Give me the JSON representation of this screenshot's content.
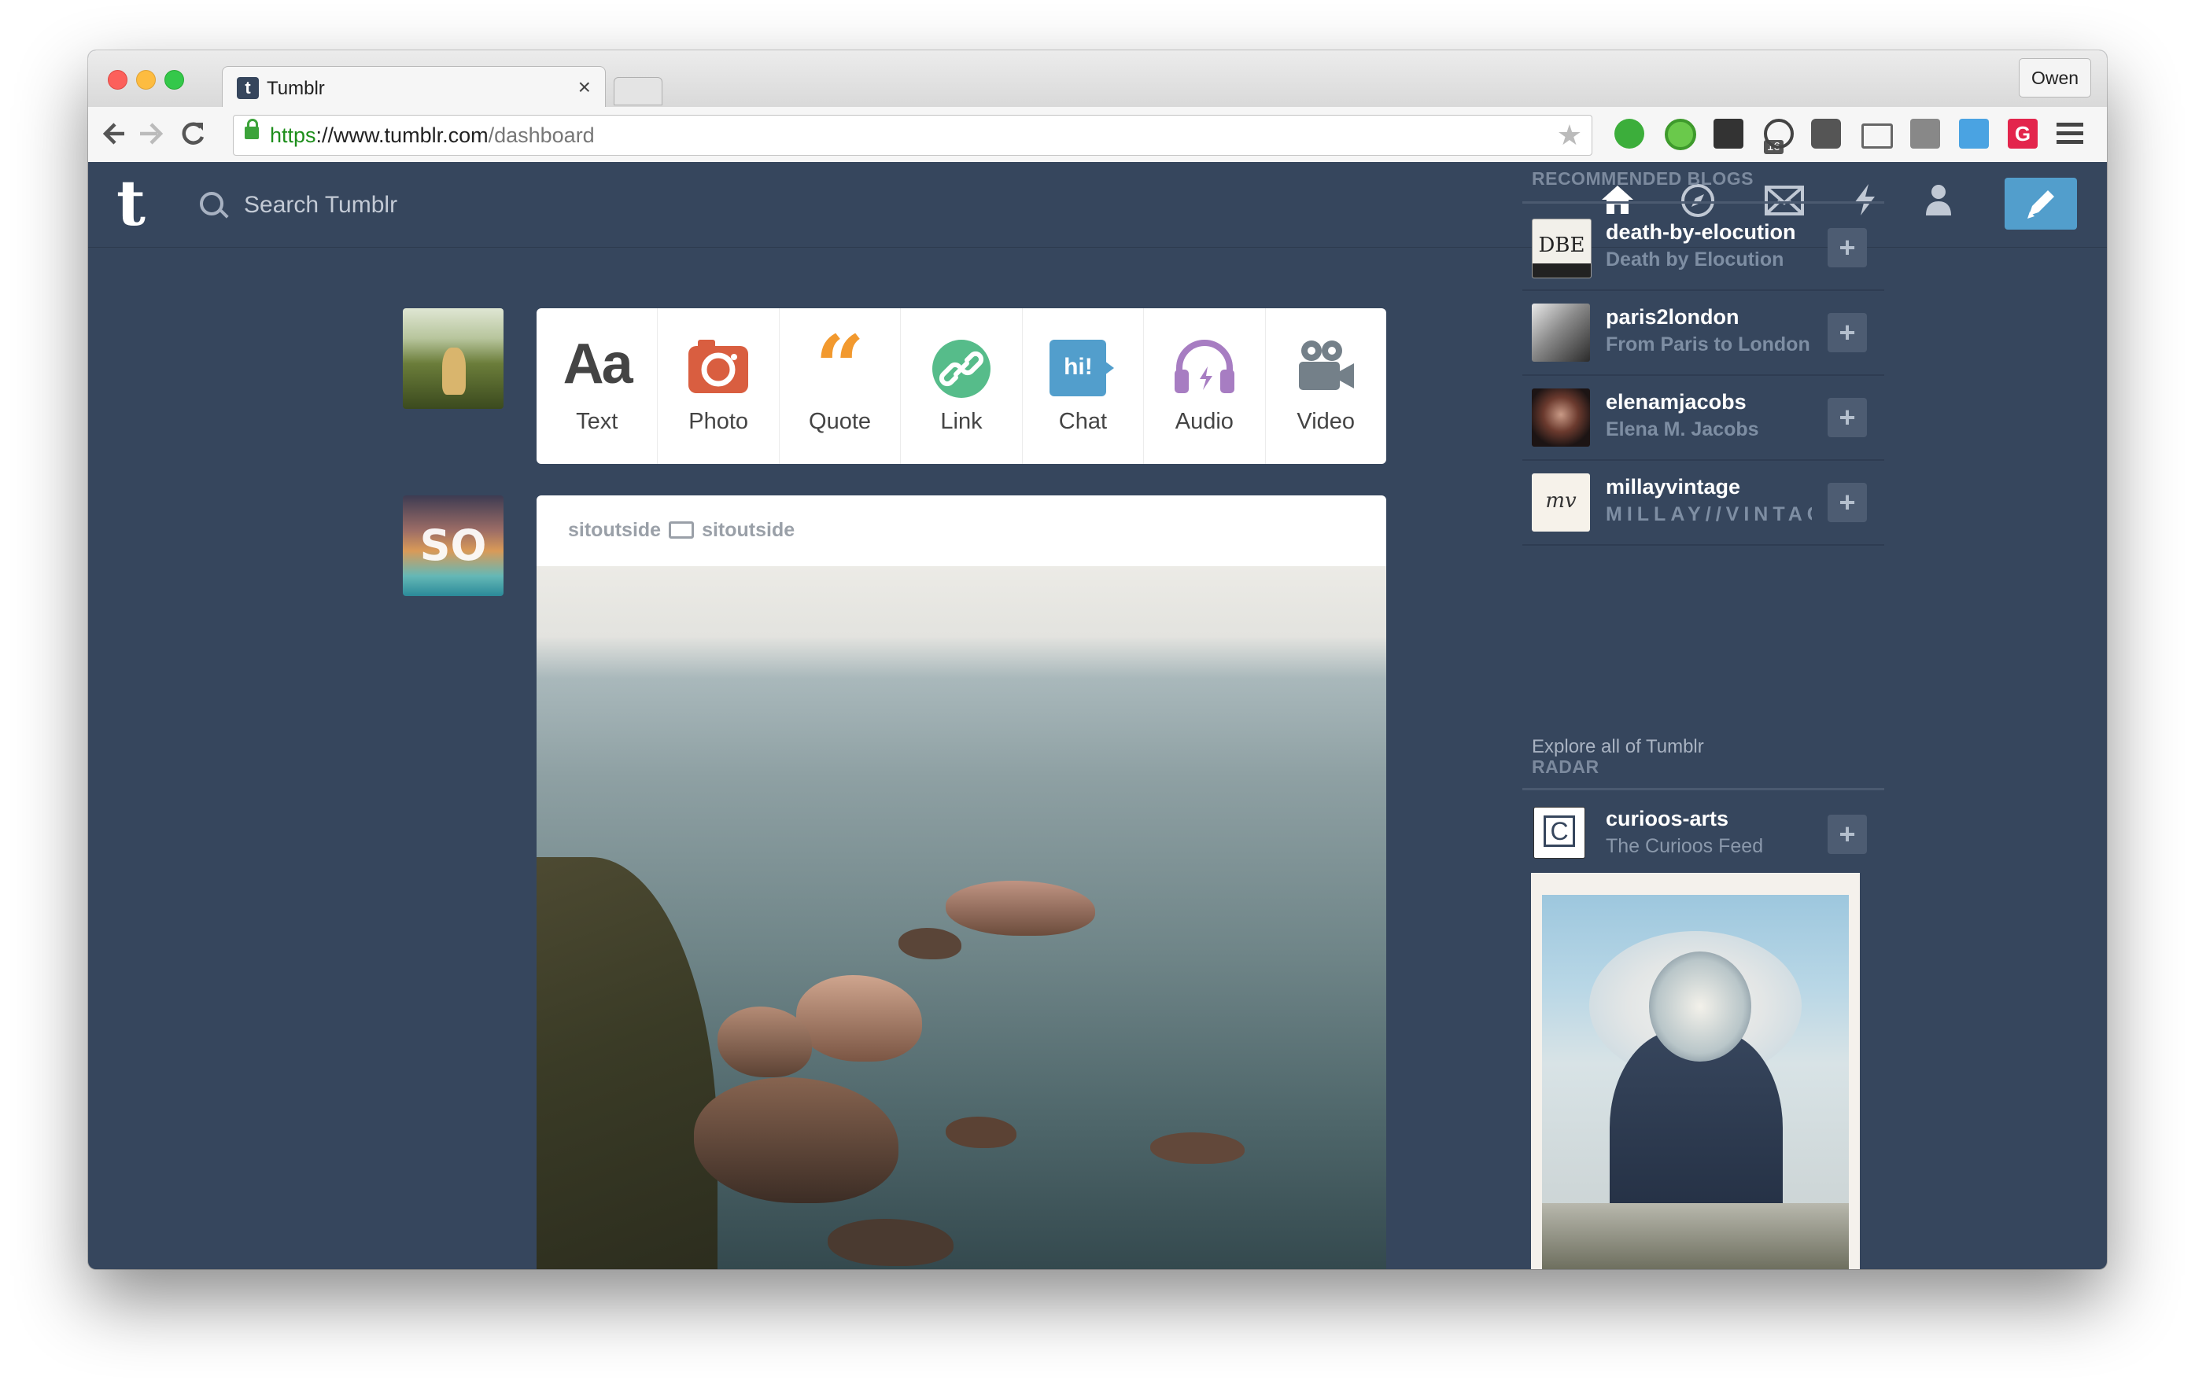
{
  "browser": {
    "tab_title": "Tumblr",
    "tab_favicon": "t",
    "tab_close": "×",
    "profile_name": "Owen",
    "url_scheme": "https",
    "url_host": "://www.tumblr.com",
    "url_path": "/dashboard",
    "extension_badge": "16"
  },
  "header": {
    "logo": "t",
    "search_placeholder": "Search Tumblr"
  },
  "post_types": [
    {
      "label": "Text",
      "glyph": "Aa",
      "icon": "text-icon"
    },
    {
      "label": "Photo",
      "icon": "camera-icon",
      "color": "#d95e40"
    },
    {
      "label": "Quote",
      "glyph": "“",
      "icon": "quote-icon",
      "color": "#f2992e"
    },
    {
      "label": "Link",
      "icon": "link-icon",
      "color": "#56bc8a"
    },
    {
      "label": "Chat",
      "glyph": "hi!",
      "icon": "chat-icon",
      "color": "#529ecc"
    },
    {
      "label": "Audio",
      "icon": "headphones-icon",
      "color": "#a77dc2"
    },
    {
      "label": "Video",
      "icon": "video-camera-icon",
      "color": "#748089"
    }
  ],
  "post": {
    "author": "sitoutside",
    "reblogged_from": "sitoutside",
    "avatar_text": "SO"
  },
  "sidebar": {
    "recommended_title": "RECOMMENDED BLOGS",
    "blogs": [
      {
        "name": "death-by-elocution",
        "title": "Death by Elocution",
        "avatar_text": "DBE"
      },
      {
        "name": "paris2london",
        "title": "From Paris to London"
      },
      {
        "name": "elenamjacobs",
        "title": "Elena M. Jacobs"
      },
      {
        "name": "millayvintage",
        "title": "MILLAY//VINTAGE",
        "avatar_text": "mv"
      }
    ],
    "explore_link": "Explore all of Tumblr",
    "radar_title": "RADAR",
    "radar_blog": {
      "name": "curioos-arts",
      "title": "The Curioos Feed",
      "avatar_text": "C"
    },
    "follow_label": "+"
  },
  "colors": {
    "tumblr_blue": "#36465d",
    "compose_blue": "#529ecc"
  }
}
